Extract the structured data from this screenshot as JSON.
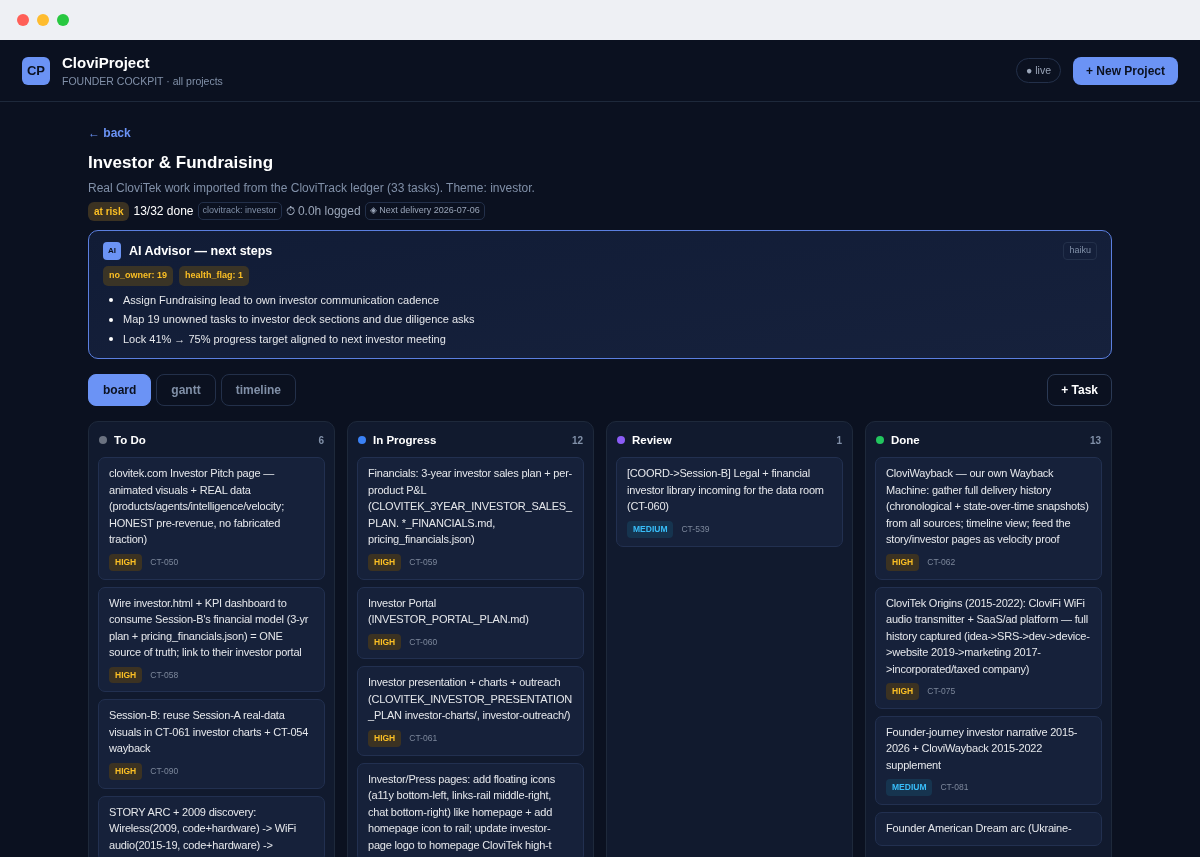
{
  "app": {
    "logo": "CP",
    "name": "CloviProject",
    "subtitle": "FOUNDER COCKPIT · all projects",
    "live": "● live",
    "new_project": "+ New Project"
  },
  "back": "← back",
  "project": {
    "title": "Investor & Fundraising",
    "description": "Real CloviTek work imported from the CloviTrack ledger (33 tasks). Theme: investor.",
    "status": "at risk",
    "done": "13/32 done",
    "tag": "clovitrack: investor",
    "logged": "⏱ 0.0h logged",
    "delivery": "◈ Next delivery 2026-07-06"
  },
  "advisor": {
    "badge": "AI",
    "title": "AI Advisor — next steps",
    "model": "haiku",
    "flags": [
      "no_owner: 19",
      "health_flag: 1"
    ],
    "steps": [
      "Assign Fundraising lead to own investor communication cadence",
      "Map 19 unowned tasks to investor deck sections and due diligence asks",
      "Lock 41% → 75% progress target aligned to next investor meeting"
    ]
  },
  "tabs": [
    {
      "label": "board",
      "selected": true
    },
    {
      "label": "gantt",
      "selected": false
    },
    {
      "label": "timeline",
      "selected": false
    }
  ],
  "add_task": "+ Task",
  "columns": [
    {
      "name": "To Do",
      "count": "6",
      "color": "#6b7280",
      "tasks": [
        {
          "text": "clovitek.com Investor Pitch page — animated visuals + REAL data (products/agents/intelligence/velocity; HONEST pre-revenue, no fabricated traction)",
          "kind": "high",
          "priority": "HIGH",
          "id": "CT-050"
        },
        {
          "text": "Wire investor.html + KPI dashboard to consume Session-B's financial model (3-yr plan + pricing_financials.json) = ONE source of truth; link to their investor portal",
          "kind": "high",
          "priority": "HIGH",
          "id": "CT-058"
        },
        {
          "text": "Session-B: reuse Session-A real-data visuals in CT-061 investor charts + CT-054 wayback",
          "kind": "high",
          "priority": "HIGH",
          "id": "CT-090"
        },
        {
          "text": "STORY ARC + 2009 discovery: Wireless(2009, code+hardware) -> WiFi audio(2015-19, code+hardware) ->"
        }
      ]
    },
    {
      "name": "In Progress",
      "count": "12",
      "color": "#3b82f6",
      "tasks": [
        {
          "text": "Financials: 3-year investor sales plan + per-product P&L (CLOVITEK_3YEAR_INVESTOR_SALES_PLAN. *_FINANCIALS.md, pricing_financials.json)",
          "kind": "high",
          "priority": "HIGH",
          "id": "CT-059"
        },
        {
          "text": "Investor Portal (INVESTOR_PORTAL_PLAN.md)",
          "kind": "high",
          "priority": "HIGH",
          "id": "CT-060"
        },
        {
          "text": "Investor presentation + charts + outreach (CLOVITEK_INVESTOR_PRESENTATION_PLAN investor-charts/, investor-outreach/)",
          "kind": "high",
          "priority": "HIGH",
          "id": "CT-061"
        },
        {
          "text": "Investor/Press pages: add floating icons (a11y bottom-left, links-rail middle-right, chat bottom-right) like homepage + add homepage icon to rail; update investor-page logo to homepage CloviTek high-t"
        }
      ]
    },
    {
      "name": "Review",
      "count": "1",
      "color": "#8b5cf6",
      "tasks": [
        {
          "text": "[COORD->Session-B] Legal + financial investor library incoming for the data room (CT-060)",
          "kind": "medium",
          "priority": "MEDIUM",
          "id": "CT-539"
        }
      ]
    },
    {
      "name": "Done",
      "count": "13",
      "color": "#22c55e",
      "tasks": [
        {
          "text": "CloviWayback — our own Wayback Machine: gather full delivery history (chronological + state-over-time snapshots) from all sources; timeline view; feed the story/investor pages as velocity proof",
          "kind": "high",
          "priority": "HIGH",
          "id": "CT-062"
        },
        {
          "text": "CloviTek Origins (2015-2022): CloviFi WiFi audio transmitter + SaaS/ad platform — full history captured (idea->SRS->dev->device->website 2019->marketing 2017->incorporated/taxed company)",
          "kind": "high",
          "priority": "HIGH",
          "id": "CT-075"
        },
        {
          "text": "Founder-journey investor narrative 2015-2026 + CloviWayback 2015-2022 supplement",
          "kind": "medium",
          "priority": "MEDIUM",
          "id": "CT-081"
        },
        {
          "text": "Founder American Dream arc (Ukraine-"
        }
      ]
    }
  ]
}
